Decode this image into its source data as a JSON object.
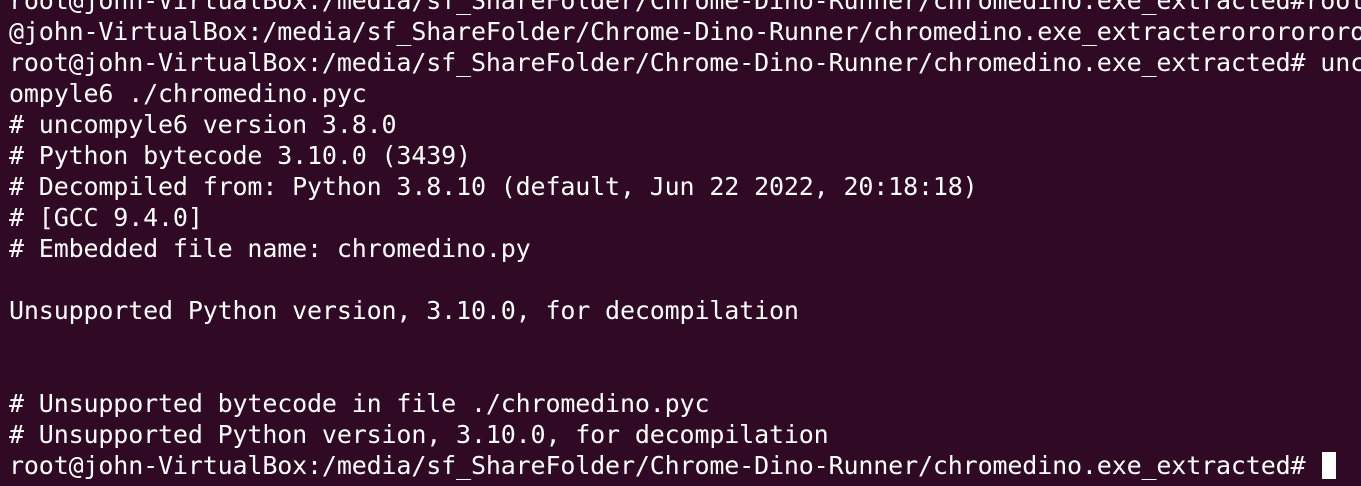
{
  "terminal": {
    "lines": [
      "root@john-VirtualBox:/media/sf_ShareFolder/Chrome-Dino-Runner/chromedino.exe_extracted#root",
      "@john-VirtualBox:/media/sf_ShareFolder/Chrome-Dino-Runner/chromedino.exe_extracterororororo",
      "root@john-VirtualBox:/media/sf_ShareFolder/Chrome-Dino-Runner/chromedino.exe_extracted# unc",
      "ompyle6 ./chromedino.pyc",
      "# uncompyle6 version 3.8.0",
      "# Python bytecode 3.10.0 (3439)",
      "# Decompiled from: Python 3.8.10 (default, Jun 22 2022, 20:18:18)",
      "# [GCC 9.4.0]",
      "# Embedded file name: chromedino.py",
      "",
      "Unsupported Python version, 3.10.0, for decompilation",
      "",
      "",
      "# Unsupported bytecode in file ./chromedino.pyc",
      "# Unsupported Python version, 3.10.0, for decompilation"
    ],
    "prompt": "root@john-VirtualBox:/media/sf_ShareFolder/Chrome-Dino-Runner/chromedino.exe_extracted# ",
    "colors": {
      "background": "#300a24",
      "foreground": "#ffffff"
    }
  }
}
